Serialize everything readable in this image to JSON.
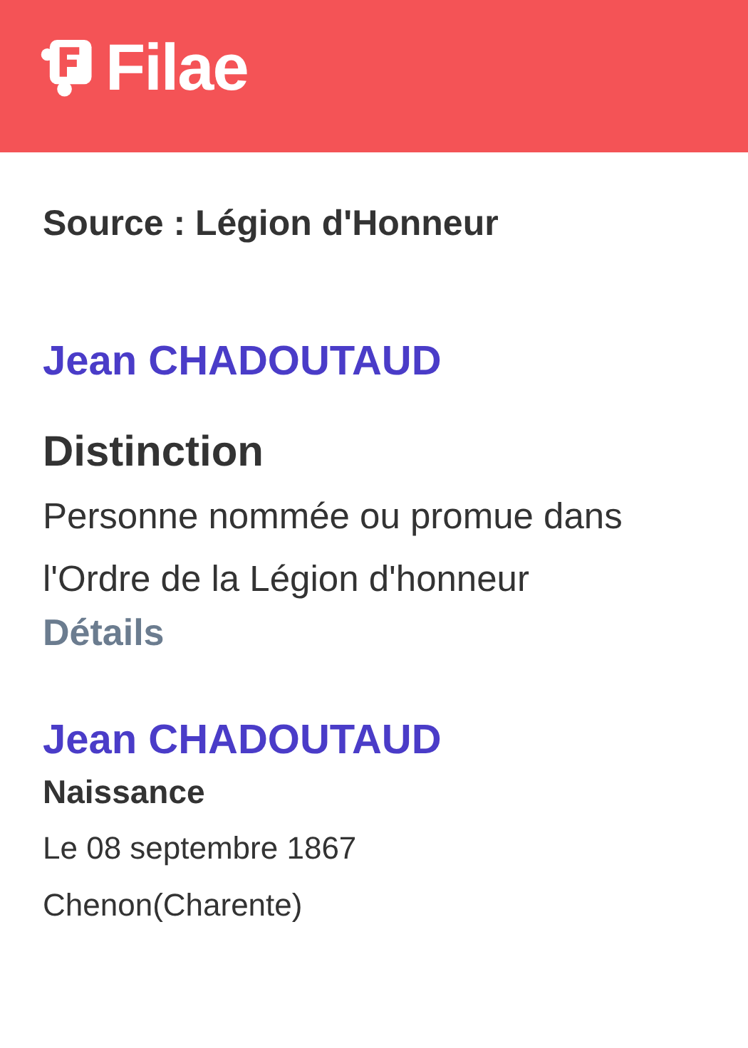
{
  "header": {
    "logo": "Filae"
  },
  "source": "Source : Légion d'Honneur",
  "records": [
    {
      "kind": "distinction",
      "name": "Jean CHADOUTAUD",
      "heading": "Distinction",
      "lines": [
        "Personne nommée ou promue dans",
        "l'Ordre de la Légion d'honneur"
      ],
      "link": "Détails"
    },
    {
      "kind": "event",
      "name": "Jean CHADOUTAUD",
      "heading": "Naissance",
      "lines": [
        "Le 08 septembre 1867",
        "Chenon(Charente)"
      ]
    }
  ]
}
